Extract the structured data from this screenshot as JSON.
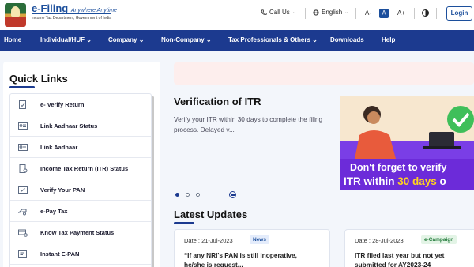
{
  "header": {
    "logo_title": "e-Filing",
    "logo_tagline": "Anywhere Anytime",
    "logo_subtitle": "Income Tax Department, Government of India",
    "call_us": "Call Us",
    "language": "English",
    "font_decrease": "A-",
    "font_normal": "A",
    "font_increase": "A+",
    "login": "Login"
  },
  "nav": {
    "items": [
      "Home",
      "Individual/HUF",
      "Company",
      "Non-Company",
      "Tax Professionals & Others",
      "Downloads",
      "Help"
    ]
  },
  "quick_links": {
    "title": "Quick Links",
    "items": [
      {
        "label": "e- Verify Return",
        "icon": "document-check-icon"
      },
      {
        "label": "Link Aadhaar Status",
        "icon": "id-card-icon"
      },
      {
        "label": "Link Aadhaar",
        "icon": "id-card-link-icon"
      },
      {
        "label": "Income Tax Return (ITR) Status",
        "icon": "document-status-icon"
      },
      {
        "label": "Verify Your PAN",
        "icon": "pan-card-icon"
      },
      {
        "label": "e-Pay Tax",
        "icon": "payment-icon"
      },
      {
        "label": "Know Tax Payment Status",
        "icon": "payment-status-icon"
      },
      {
        "label": "Instant E-PAN",
        "icon": "epan-icon"
      }
    ]
  },
  "feature": {
    "title": "Verification of ITR",
    "description": "Verify your ITR within 30 days to complete the filing process. Delayed v...",
    "promo_line1": "Don't forget to verify",
    "promo_line2_a": "ITR within ",
    "promo_line2_b": "30 days",
    "promo_line2_c": " o"
  },
  "latest_updates": {
    "title": "Latest Updates",
    "cards": [
      {
        "date": "Date : 21-Jul-2023",
        "badge": "News",
        "text": "“If any NRI's PAN is still inoperative, he/she is request..."
      },
      {
        "date": "Date : 28-Jul-2023",
        "badge": "e-Campaign",
        "text": "ITR filed last year but not yet submitted for AY2023-24"
      }
    ]
  },
  "colors": {
    "nav_bg": "#1c3a8f",
    "brand_blue": "#1c4f9c",
    "promo_purple": "#6c2bd9",
    "promo_highlight": "#ffd21f",
    "alert_bg": "#fdeeed"
  }
}
